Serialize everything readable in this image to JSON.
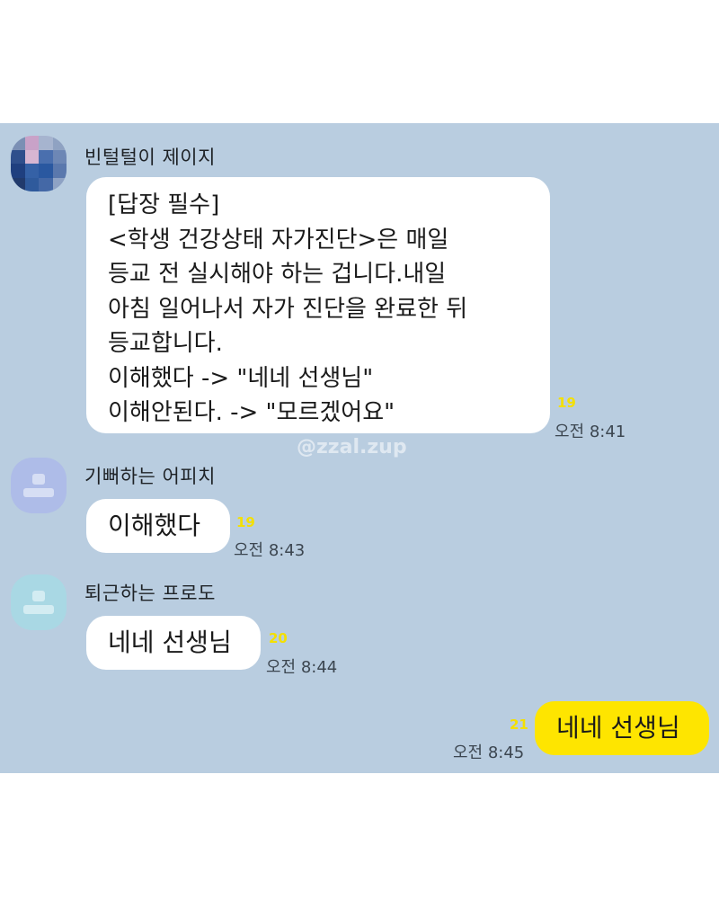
{
  "colors": {
    "chat_background": "#b9cde0",
    "bubble_incoming": "#ffffff",
    "bubble_outgoing": "#fee500",
    "unread_count": "#f4e000"
  },
  "watermark": "@zzal.zup",
  "messages": [
    {
      "sender": "빈털털이 제이지",
      "avatar": "pixelated-profile-icon",
      "lines": [
        "[답장 필수]",
        "<학생 건강상태 자가진단>은 매일",
        "등교 전 실시해야 하는 겁니다.내일",
        "아침 일어나서 자가 진단을 완료한 뒤",
        "등교합니다.",
        "이해했다 -> \"네네 선생님\"",
        "이해안된다. -> \"모르겠어요\""
      ],
      "unread": "19",
      "time": "오전 8:41"
    },
    {
      "sender": "기뻐하는 어피치",
      "avatar": "default-profile-icon",
      "text": "이해했다",
      "unread": "19",
      "time": "오전 8:43"
    },
    {
      "sender": "퇴근하는 프로도",
      "avatar": "default-profile-icon",
      "text": "네네 선생님",
      "unread": "20",
      "time": "오전 8:44"
    },
    {
      "sender": "",
      "mine": true,
      "text": "네네 선생님",
      "unread": "21",
      "time": "오전 8:45"
    }
  ]
}
